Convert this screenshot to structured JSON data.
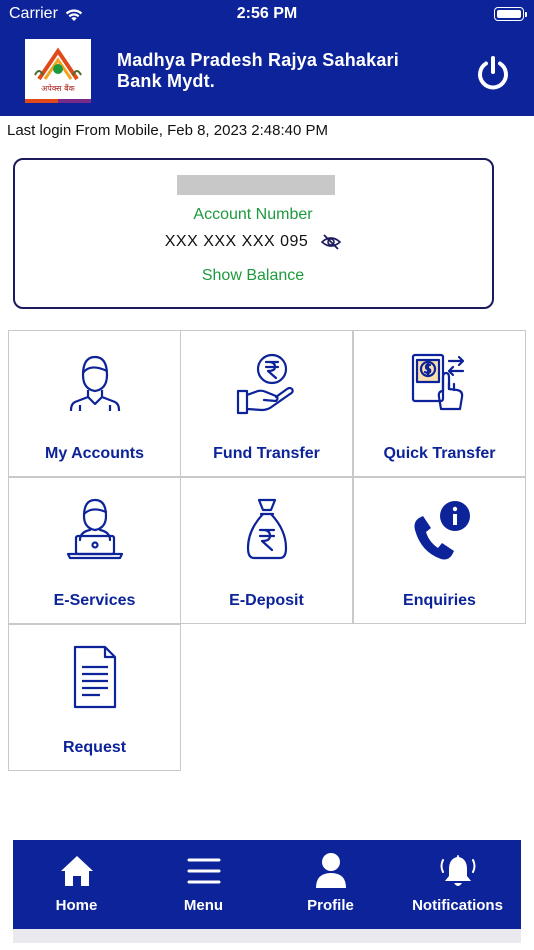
{
  "status_bar": {
    "carrier": "Carrier",
    "time": "2:56 PM",
    "icons": [
      "wifi-icon",
      "battery-icon"
    ]
  },
  "header": {
    "logo_text": "अपेक्स बैंक",
    "bank_name": "Madhya Pradesh Rajya Sahakari Bank Mydt.",
    "power_icon": "power-icon",
    "color": "#0d2399"
  },
  "last_login": "Last login From Mobile, Feb 8, 2023 2:48:40 PM",
  "account_card": {
    "label": "Account Number",
    "number": "XXX XXX XXX 095",
    "visibility_icon": "eye-slash-icon",
    "show_balance": "Show Balance",
    "label_color": "#1e9a3e"
  },
  "tiles": [
    {
      "label": "My Accounts",
      "icon": "user-icon"
    },
    {
      "label": "Fund Transfer",
      "icon": "rupee-hand-icon"
    },
    {
      "label": "Quick Transfer",
      "icon": "quick-transfer-icon"
    },
    {
      "label": "E-Services",
      "icon": "laptop-user-icon"
    },
    {
      "label": "E-Deposit",
      "icon": "money-bag-icon"
    },
    {
      "label": "Enquiries",
      "icon": "phone-info-icon"
    },
    {
      "label": "Request",
      "icon": "document-icon"
    }
  ],
  "bottom_nav": [
    {
      "label": "Home",
      "icon": "home-icon"
    },
    {
      "label": "Menu",
      "icon": "menu-icon"
    },
    {
      "label": "Profile",
      "icon": "profile-icon"
    },
    {
      "label": "Notifications",
      "icon": "bell-icon"
    }
  ]
}
